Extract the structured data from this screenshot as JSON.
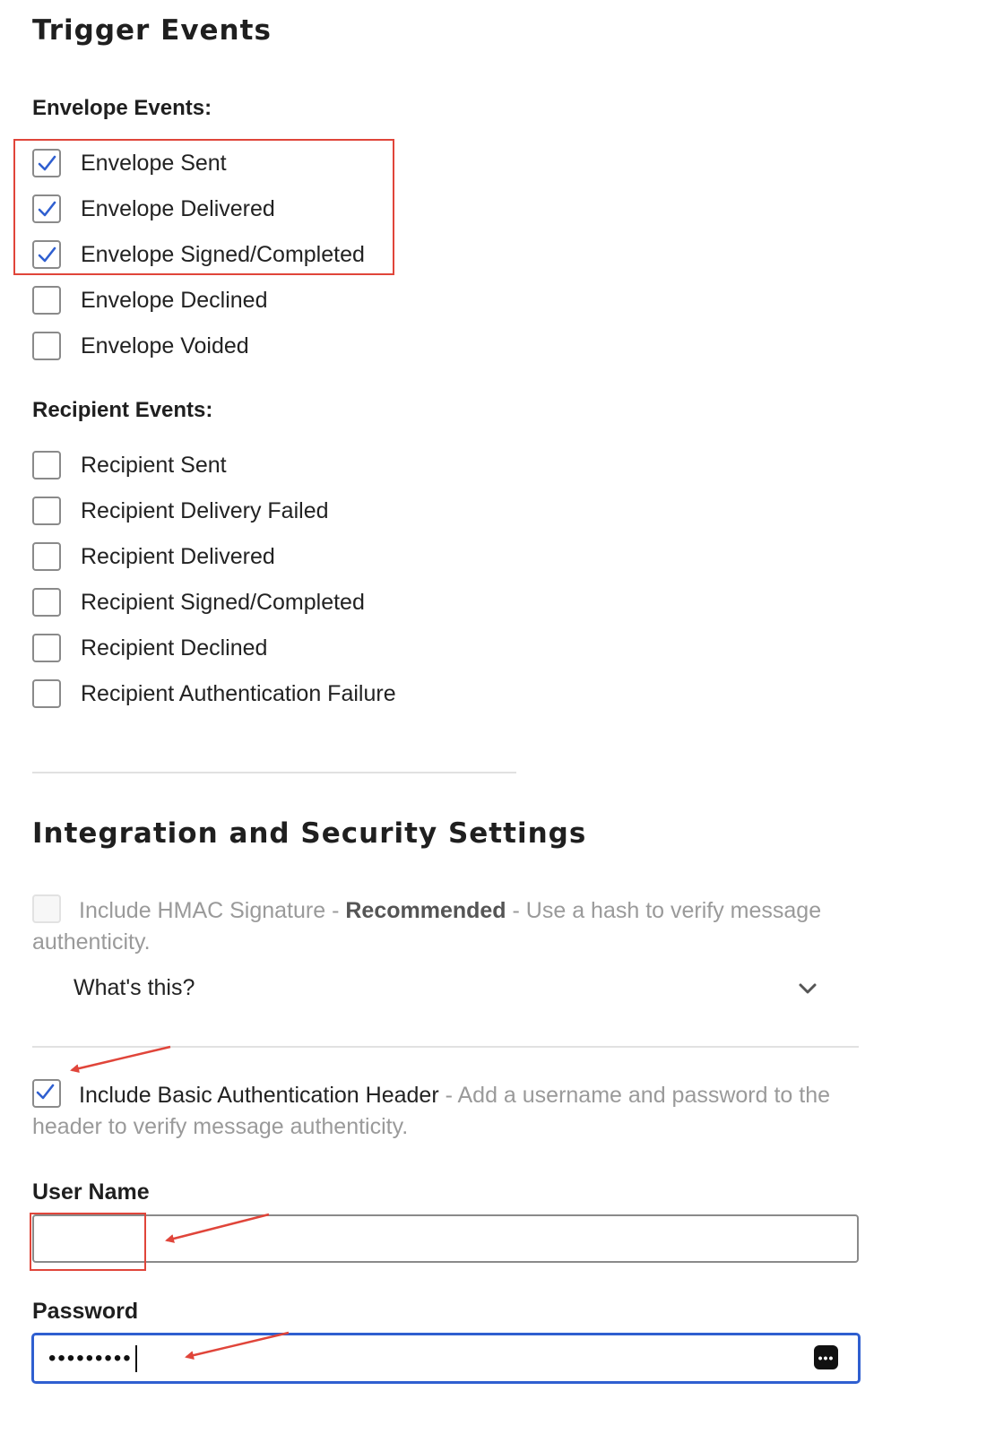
{
  "trigger": {
    "title": "Trigger Events",
    "envelope_label": "Envelope Events:",
    "envelope_events": [
      {
        "label": "Envelope Sent",
        "checked": true
      },
      {
        "label": "Envelope Delivered",
        "checked": true
      },
      {
        "label": "Envelope Signed/Completed",
        "checked": true
      },
      {
        "label": "Envelope Declined",
        "checked": false
      },
      {
        "label": "Envelope Voided",
        "checked": false
      }
    ],
    "recipient_label": "Recipient Events:",
    "recipient_events": [
      {
        "label": "Recipient Sent",
        "checked": false
      },
      {
        "label": "Recipient Delivery Failed",
        "checked": false
      },
      {
        "label": "Recipient Delivered",
        "checked": false
      },
      {
        "label": "Recipient Signed/Completed",
        "checked": false
      },
      {
        "label": "Recipient Declined",
        "checked": false
      },
      {
        "label": "Recipient Authentication Failure",
        "checked": false
      }
    ]
  },
  "integration": {
    "title": "Integration and Security Settings",
    "hmac": {
      "label": "Include HMAC Signature",
      "sep1": " - ",
      "emphasis": "Recommended",
      "sep2": " - Use a hash to verify message authenticity.",
      "checked": false,
      "disabled": true
    },
    "whats_this": "What's this?",
    "basic_auth": {
      "label": "Include Basic Authentication Header",
      "desc": " - Add a username and password to the header to verify message authenticity.",
      "checked": true
    },
    "username": {
      "label": "User Name",
      "value": ""
    },
    "password": {
      "label": "Password",
      "masked_value": "•••••••••",
      "key_icon_text": "•••"
    }
  },
  "colors": {
    "check": "#2f5fd0",
    "annotation": "#e0453a",
    "focus_border": "#2f5fd0"
  },
  "icons": {
    "checkmark": "checkmark-icon",
    "chevron": "chevron-down-icon",
    "password_manager": "password-key-icon"
  }
}
